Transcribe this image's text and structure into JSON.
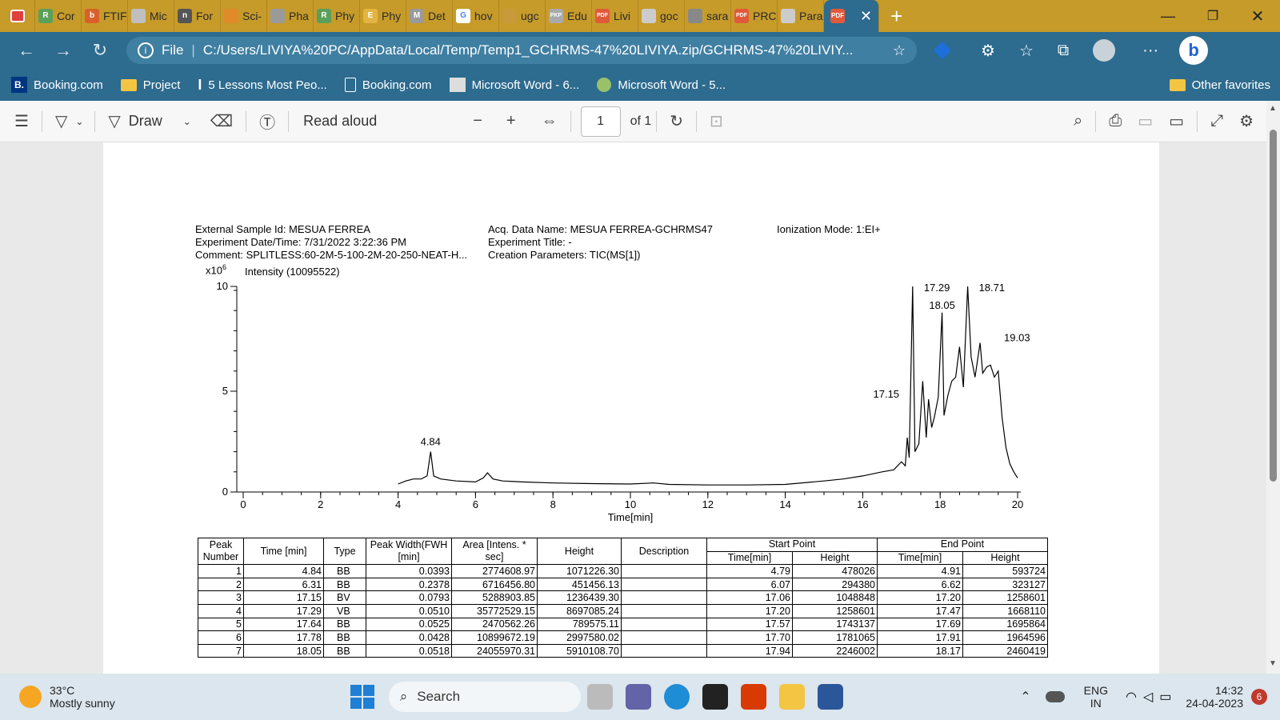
{
  "browser": {
    "tabs": [
      {
        "label": "Cor",
        "color": "#5aa05a",
        "text": "R"
      },
      {
        "label": "FTIF",
        "color": "#d9602b",
        "text": "b"
      },
      {
        "label": "Mic",
        "color": "#bfbfbf",
        "text": ""
      },
      {
        "label": "For",
        "color": "#555555",
        "text": "n"
      },
      {
        "label": "Sci-",
        "color": "#e08a2a",
        "text": ""
      },
      {
        "label": "Pha",
        "color": "#9a9a9a",
        "text": ""
      },
      {
        "label": "Phy",
        "color": "#5aa05a",
        "text": "R"
      },
      {
        "label": "Phy",
        "color": "#e2b542",
        "text": "E"
      },
      {
        "label": "Det",
        "color": "#9a9a9a",
        "text": "M"
      },
      {
        "label": "hov",
        "color": "#ffffff",
        "text": "G"
      },
      {
        "label": "ugc",
        "color": "#c99a3a",
        "text": ""
      },
      {
        "label": "Edu",
        "color": "#aaaaaa",
        "text": "PKP"
      },
      {
        "label": "Livi",
        "color": "#e05a3a",
        "text": "PDF"
      },
      {
        "label": "goc",
        "color": "#cccccc",
        "text": ""
      },
      {
        "label": "sara",
        "color": "#888888",
        "text": ""
      },
      {
        "label": "PRC",
        "color": "#e05a3a",
        "text": "PDF"
      },
      {
        "label": "Para",
        "color": "#cccccc",
        "text": ""
      }
    ],
    "active_tab_icon": "PDF",
    "url_prefix": "File",
    "url": "C:/Users/LIVIYA%20PC/AppData/Local/Temp/Temp1_GCHRMS-47%20LIVIYA.zip/GCHRMS-47%20LIVIY...",
    "bookmarks": [
      "Booking.com",
      "Project",
      "5 Lessons Most Peo...",
      "Booking.com",
      "Microsoft Word - 6...",
      "Microsoft Word - 5..."
    ],
    "other_favorites": "Other favorites"
  },
  "pdf_toolbar": {
    "draw": "Draw",
    "read_aloud": "Read aloud",
    "page_current": "1",
    "page_total": "of 1"
  },
  "document": {
    "external_sample_id": "External Sample Id: MESUA FERREA",
    "experiment_datetime": "Experiment Date/Time: 7/31/2022 3:22:36 PM",
    "comment": "Comment: SPLITLESS:60-2M-5-100-2M-20-250-NEAT-H...",
    "acq_data_name": "Acq. Data Name: MESUA FERREA-GCHRMS47",
    "experiment_title": "Experiment Title: -",
    "creation_parameters": "Creation Parameters: TIC(MS[1])",
    "ionization_mode": "Ionization Mode: 1:EI+",
    "y_scale": "x10",
    "y_scale_exp": "6",
    "intensity_label": "Intensity (10095522)"
  },
  "chart_data": {
    "type": "line",
    "xlabel": "Time[min]",
    "ylabel": "",
    "xlim": [
      0,
      20
    ],
    "ylim": [
      0,
      10
    ],
    "xticks": [
      0,
      2,
      4,
      6,
      8,
      10,
      12,
      14,
      16,
      18,
      20
    ],
    "yticks": [
      0,
      5,
      10
    ],
    "peak_labels": [
      {
        "x": 4.84,
        "label": "4.84"
      },
      {
        "x": 17.15,
        "label": "17.15"
      },
      {
        "x": 17.29,
        "label": "17.29"
      },
      {
        "x": 18.05,
        "label": "18.05"
      },
      {
        "x": 18.71,
        "label": "18.71"
      },
      {
        "x": 19.03,
        "label": "19.03"
      }
    ],
    "series": [
      {
        "x": [
          4.0,
          4.2,
          4.4,
          4.6,
          4.75,
          4.84,
          4.92,
          5.1,
          5.5,
          6.0,
          6.2,
          6.31,
          6.45,
          6.7,
          7.2,
          8.0,
          9.0,
          10.0,
          10.6,
          11.0,
          12.0,
          13.0,
          14.0,
          15.0,
          15.5,
          16.0,
          16.5,
          16.8,
          17.0,
          17.1,
          17.15,
          17.2,
          17.29,
          17.35,
          17.45,
          17.55,
          17.64,
          17.7,
          17.78,
          17.85,
          17.95,
          18.05,
          18.1,
          18.2,
          18.3,
          18.4,
          18.5,
          18.6,
          18.71,
          18.8,
          18.9,
          19.03,
          19.1,
          19.2,
          19.3,
          19.4,
          19.5,
          19.6,
          19.7,
          19.8,
          19.9,
          20.0
        ],
        "values": [
          0.2,
          0.35,
          0.45,
          0.45,
          0.6,
          1.8,
          0.6,
          0.45,
          0.35,
          0.3,
          0.5,
          0.75,
          0.45,
          0.35,
          0.3,
          0.25,
          0.22,
          0.2,
          0.25,
          0.18,
          0.15,
          0.15,
          0.18,
          0.35,
          0.45,
          0.6,
          0.8,
          0.9,
          1.3,
          1.1,
          2.5,
          1.5,
          10.0,
          1.8,
          2.2,
          5.3,
          2.5,
          4.4,
          3.0,
          3.5,
          4.5,
          8.7,
          3.6,
          4.6,
          5.3,
          5.5,
          7.0,
          5.0,
          10.0,
          6.5,
          5.5,
          7.2,
          5.7,
          6.0,
          6.1,
          5.5,
          5.8,
          3.5,
          2.0,
          1.2,
          0.8,
          0.5
        ]
      }
    ]
  },
  "peak_table": {
    "headers": {
      "peak_number": "Peak Number",
      "time": "Time [min]",
      "type": "Type",
      "peak_width": "Peak Width(FWH [min]",
      "area": "Area [Intens. * sec]",
      "height": "Height",
      "description": "Description",
      "start_point": "Start Point",
      "end_point": "End Point",
      "sp_time": "Time[min]",
      "sp_height": "Height",
      "ep_time": "Time[min]",
      "ep_height": "Height"
    },
    "rows": [
      [
        "1",
        "4.84",
        "BB",
        "0.0393",
        "2774608.97",
        "1071226.30",
        "",
        "4.79",
        "478026",
        "4.91",
        "593724"
      ],
      [
        "2",
        "6.31",
        "BB",
        "0.2378",
        "6716456.80",
        "451456.13",
        "",
        "6.07",
        "294380",
        "6.62",
        "323127"
      ],
      [
        "3",
        "17.15",
        "BV",
        "0.0793",
        "5288903.85",
        "1236439.30",
        "",
        "17.06",
        "1048848",
        "17.20",
        "1258601"
      ],
      [
        "4",
        "17.29",
        "VB",
        "0.0510",
        "35772529.15",
        "8697085.24",
        "",
        "17.20",
        "1258601",
        "17.47",
        "1668110"
      ],
      [
        "5",
        "17.64",
        "BB",
        "0.0525",
        "2470562.26",
        "789575.11",
        "",
        "17.57",
        "1743137",
        "17.69",
        "1695864"
      ],
      [
        "6",
        "17.78",
        "BB",
        "0.0428",
        "10899672.19",
        "2997580.02",
        "",
        "17.70",
        "1781065",
        "17.91",
        "1964596"
      ],
      [
        "7",
        "18.05",
        "BB",
        "0.0518",
        "24055970.31",
        "5910108.70",
        "",
        "17.94",
        "2246002",
        "18.17",
        "2460419"
      ]
    ]
  },
  "taskbar": {
    "temperature": "33°C",
    "weather": "Mostly sunny",
    "search": "Search",
    "lang": "ENG",
    "region": "IN",
    "time": "14:32",
    "date": "24-04-2023",
    "notifications": "6"
  }
}
